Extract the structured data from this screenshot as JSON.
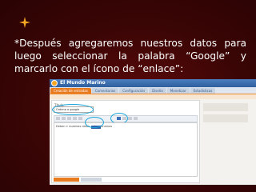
{
  "slide": {
    "bullet_text": "*Después agregaremos nuestros datos para luego seleccionar la palabra “Google” y marcarlo con el ícono de “enlace”:"
  },
  "screenshot": {
    "blog_name": "El Mundo Marino",
    "tabs": [
      "Creación de entradas",
      "Comentarios",
      "Configuración",
      "Diseño",
      "Monetizar",
      "Estadísticas"
    ],
    "active_tab_index": 0,
    "field_label": "Título:",
    "title_value": "Ordena a google",
    "editor_text": "Deben ir nuestras datos, seleccionamos ",
    "selected_word": "Google",
    "publish_label": "PUBLICAR ENTRADA",
    "draft_label": "GUARDAR AHORA",
    "draft_note": "Borrador guardado a las 11:10"
  },
  "colors": {
    "background": "#4a0707",
    "accent_star": "#f5a623",
    "highlight_circle": "#1aa6d9"
  }
}
